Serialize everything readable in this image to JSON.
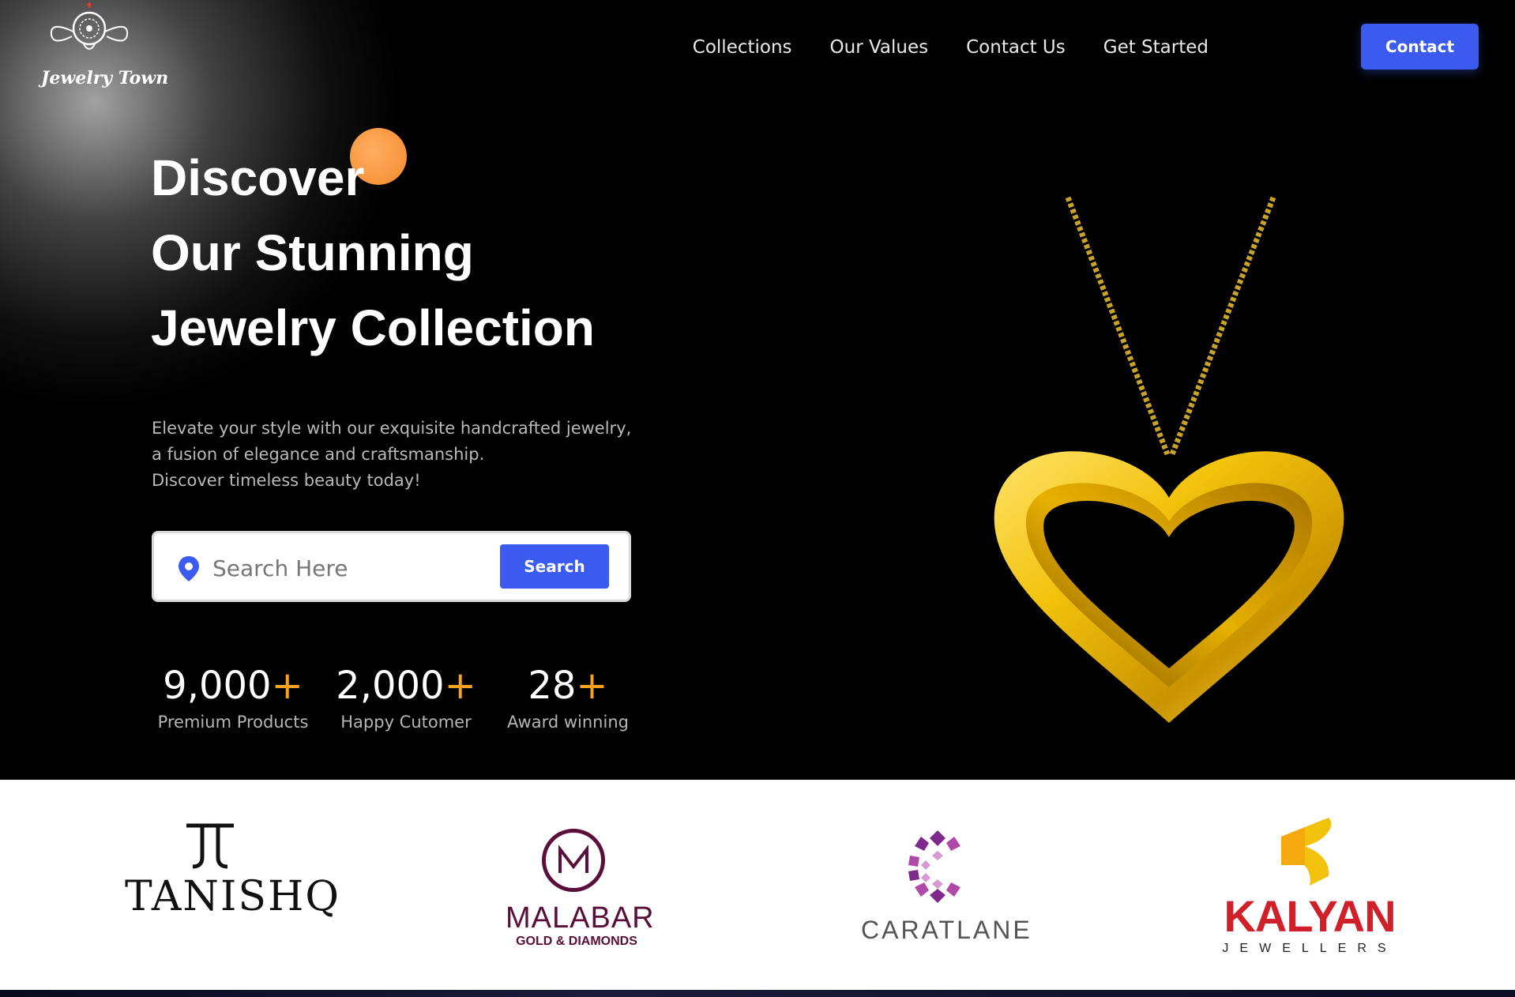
{
  "brand": {
    "name": "Jewelry Town"
  },
  "nav": {
    "links": [
      "Collections",
      "Our Values",
      "Contact Us",
      "Get Started"
    ],
    "contact_label": "Contact"
  },
  "hero": {
    "headline": [
      "Discover",
      "Our Stunning",
      "Jewelry Collection"
    ],
    "description": [
      "Elevate your style with our exquisite handcrafted jewelry,",
      "a fusion of elegance and craftsmanship.",
      "Discover timeless beauty today!"
    ],
    "search": {
      "placeholder": "Search Here",
      "value": "",
      "button_label": "Search"
    },
    "stats": [
      {
        "value": "9,000",
        "suffix": "+",
        "label": "Premium Products"
      },
      {
        "value": "2,000",
        "suffix": "+",
        "label": "Happy Cutomer"
      },
      {
        "value": "28",
        "suffix": "+",
        "label": "Award winning"
      }
    ]
  },
  "partners": {
    "tanishq": {
      "name": "TANISHQ"
    },
    "malabar": {
      "name": "MALABAR",
      "sub": "GOLD & DIAMONDS"
    },
    "caratlane": {
      "name": "CARATLANE"
    },
    "kalyan": {
      "name": "KALYAN",
      "sub": "JEWELLERS"
    }
  },
  "colors": {
    "accent": "#3b5bf0",
    "orange": "#f4a21f",
    "gold": "#f2c20c",
    "malabar": "#5a0f3a",
    "kalyan": "#d0202a"
  },
  "icons": {
    "logo": "ornament-logo-icon",
    "search_pin": "location-pin-icon",
    "necklace": "gold-heart-necklace-image"
  }
}
